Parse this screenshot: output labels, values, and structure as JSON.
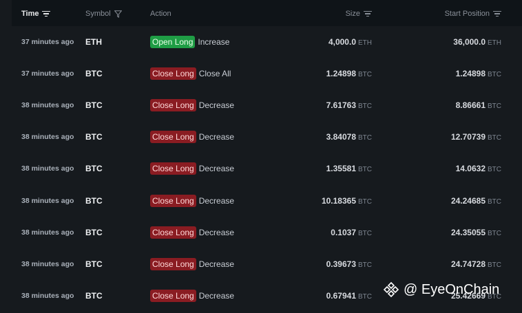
{
  "header": {
    "time": "Time",
    "symbol": "Symbol",
    "action": "Action",
    "size": "Size",
    "start_position": "Start Position"
  },
  "rows": [
    {
      "time": "37 minutes ago",
      "symbol": "ETH",
      "badge": "Open Long",
      "badge_kind": "open",
      "action_type": "Increase",
      "size": "4,000.0",
      "size_unit": "ETH",
      "start": "36,000.0",
      "start_unit": "ETH"
    },
    {
      "time": "37 minutes ago",
      "symbol": "BTC",
      "badge": "Close Long",
      "badge_kind": "close",
      "action_type": "Close All",
      "size": "1.24898",
      "size_unit": "BTC",
      "start": "1.24898",
      "start_unit": "BTC"
    },
    {
      "time": "38 minutes ago",
      "symbol": "BTC",
      "badge": "Close Long",
      "badge_kind": "close",
      "action_type": "Decrease",
      "size": "7.61763",
      "size_unit": "BTC",
      "start": "8.86661",
      "start_unit": "BTC"
    },
    {
      "time": "38 minutes ago",
      "symbol": "BTC",
      "badge": "Close Long",
      "badge_kind": "close",
      "action_type": "Decrease",
      "size": "3.84078",
      "size_unit": "BTC",
      "start": "12.70739",
      "start_unit": "BTC"
    },
    {
      "time": "38 minutes ago",
      "symbol": "BTC",
      "badge": "Close Long",
      "badge_kind": "close",
      "action_type": "Decrease",
      "size": "1.35581",
      "size_unit": "BTC",
      "start": "14.0632",
      "start_unit": "BTC"
    },
    {
      "time": "38 minutes ago",
      "symbol": "BTC",
      "badge": "Close Long",
      "badge_kind": "close",
      "action_type": "Decrease",
      "size": "10.18365",
      "size_unit": "BTC",
      "start": "24.24685",
      "start_unit": "BTC"
    },
    {
      "time": "38 minutes ago",
      "symbol": "BTC",
      "badge": "Close Long",
      "badge_kind": "close",
      "action_type": "Decrease",
      "size": "0.1037",
      "size_unit": "BTC",
      "start": "24.35055",
      "start_unit": "BTC"
    },
    {
      "time": "38 minutes ago",
      "symbol": "BTC",
      "badge": "Close Long",
      "badge_kind": "close",
      "action_type": "Decrease",
      "size": "0.39673",
      "size_unit": "BTC",
      "start": "24.74728",
      "start_unit": "BTC"
    },
    {
      "time": "38 minutes ago",
      "symbol": "BTC",
      "badge": "Close Long",
      "badge_kind": "close",
      "action_type": "Decrease",
      "size": "0.67941",
      "size_unit": "BTC",
      "start": "25.42669",
      "start_unit": "BTC"
    }
  ],
  "watermark": {
    "text": "@ EyeOnChain"
  },
  "colors": {
    "open_long": "#1f9d45",
    "close_long": "#8a1c22",
    "background": "#161a1e"
  }
}
